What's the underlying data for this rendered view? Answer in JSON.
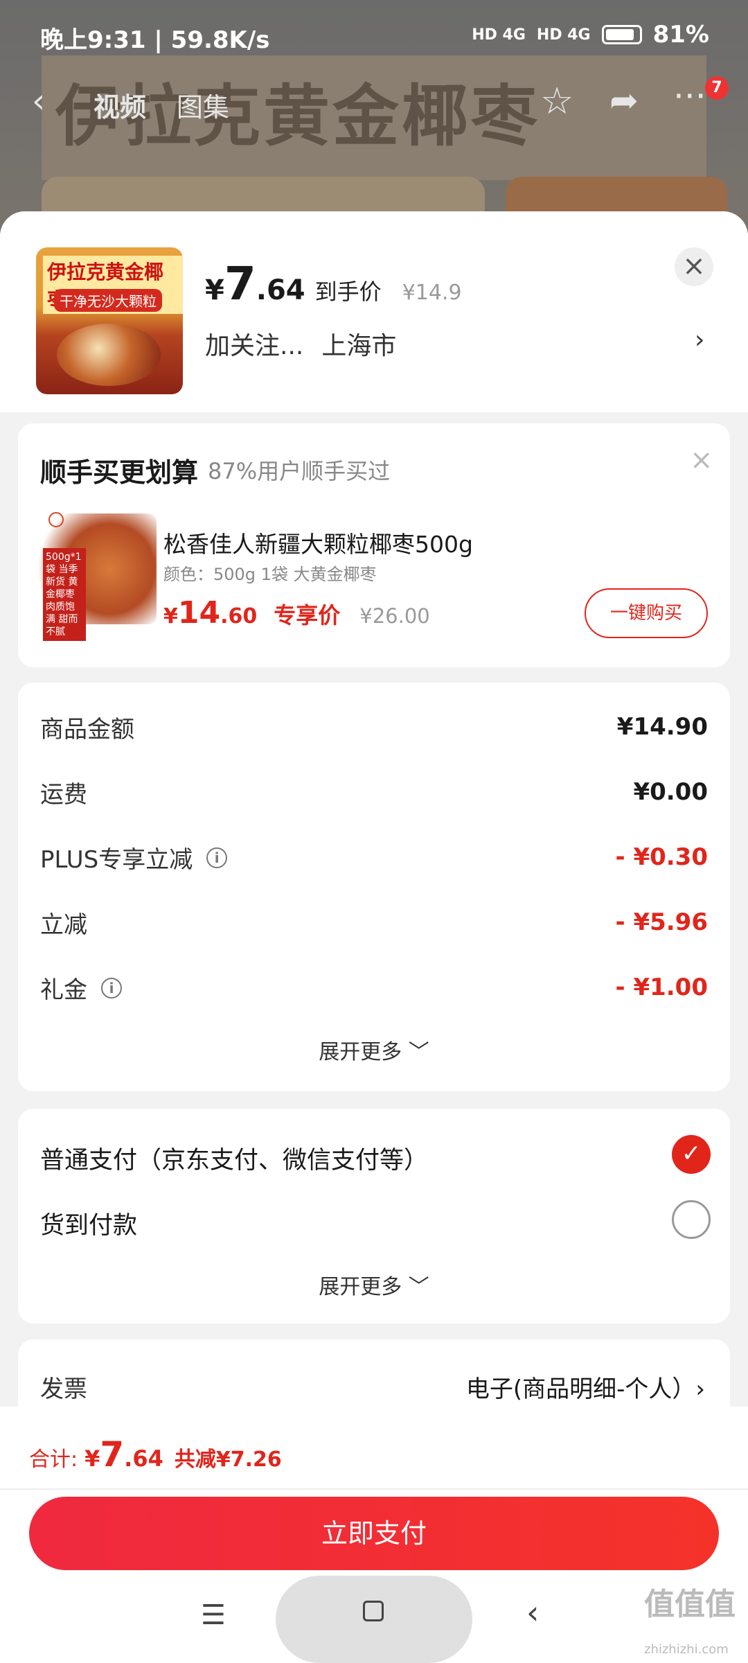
{
  "status": {
    "time": "晚上9:31 | 59.8K/s",
    "signal1": "HD 4G",
    "signal2": "HD 4G",
    "battery": "81%"
  },
  "top_nav": {
    "tab_video": "视频",
    "tab_gallery": "图集",
    "badge": "7"
  },
  "background_title": "伊拉克黄金椰枣",
  "product": {
    "thumb_title": "伊拉克黄金椰枣",
    "thumb_sub": "干净无沙大颗粒",
    "price_currency": "¥",
    "price_int": "7",
    "price_dec": ".64",
    "price_tag": "到手价",
    "price_original": "¥14.9",
    "follow": "加关注...",
    "location": "上海市"
  },
  "bundle": {
    "title": "顺手买更划算",
    "subtitle": "87%用户顺手买过",
    "img_tag": "500g*1袋 当季新货 黄金椰枣 肉质饱满 甜而不腻",
    "name": "松香佳人新疆大颗粒椰枣500g",
    "spec": "颜色：500g 1袋 大黄金椰枣",
    "price_currency": "¥",
    "price_int": "14",
    "price_dec": ".60",
    "price_tag": "专享价",
    "price_original": "¥26.00",
    "buy_label": "一键购买"
  },
  "price_details": {
    "rows": [
      {
        "label": "商品金额",
        "value": "¥14.90"
      },
      {
        "label": "运费",
        "value": "¥0.00"
      },
      {
        "label": "PLUS专享立减",
        "value": "- ¥0.30"
      },
      {
        "label": "立减",
        "value": "- ¥5.96"
      },
      {
        "label": "礼金",
        "value": "- ¥1.00"
      }
    ],
    "expand": "展开更多 ﹀"
  },
  "payment": {
    "option1": "普通支付（京东支付、微信支付等）",
    "option2": "货到付款",
    "expand": "展开更多 ﹀"
  },
  "invoice": {
    "label": "发票",
    "value": "电子(商品明细-个人）›"
  },
  "footer": {
    "total_label": "合计:",
    "total_currency": "¥",
    "total_int": "7",
    "total_dec": ".64",
    "total_saved": "共减¥7.26",
    "pay_button": "立即支付"
  },
  "watermark": {
    "main": "值值值",
    "sub": "zhizhizhi.com"
  },
  "colors": {
    "accent": "#e1251b",
    "pay_button": "#f0293f"
  }
}
